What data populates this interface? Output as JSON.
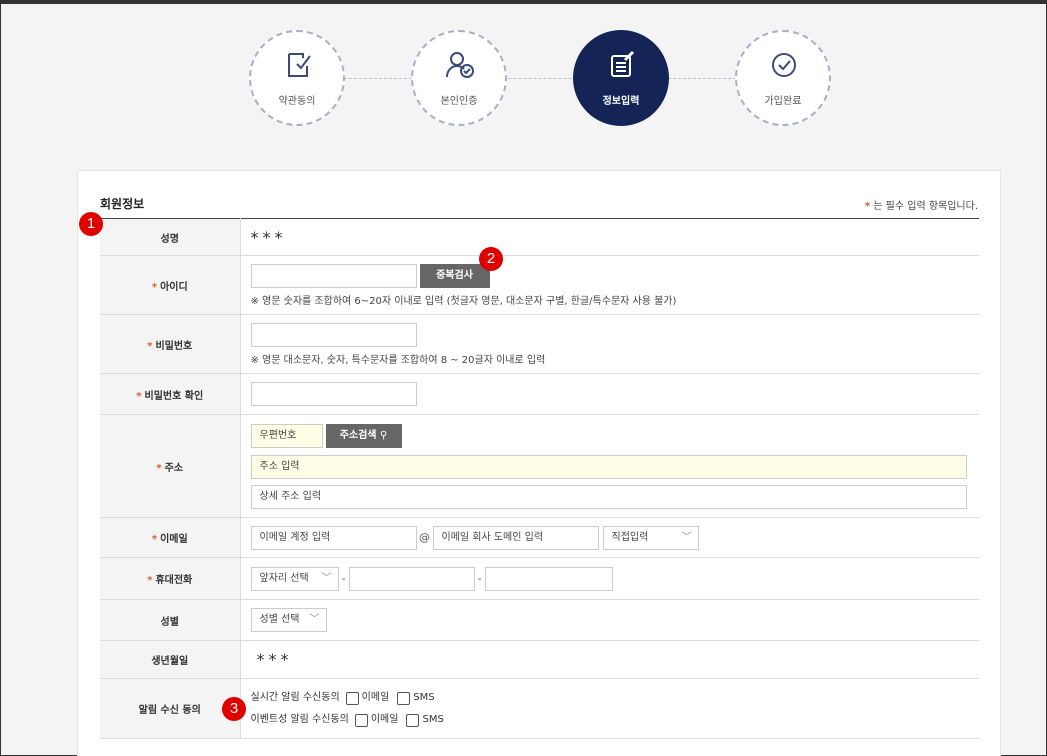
{
  "steps": [
    {
      "label": "약관동의",
      "icon": "document-check-icon",
      "active": false
    },
    {
      "label": "본인인증",
      "icon": "user-verify-icon",
      "active": false
    },
    {
      "label": "정보입력",
      "icon": "edit-document-icon",
      "active": true
    },
    {
      "label": "가입완료",
      "icon": "check-circle-icon",
      "active": false
    }
  ],
  "section": {
    "title": "회원정보",
    "required_star": "*",
    "required_note": "는 필수 입력 항목입니다."
  },
  "rows": {
    "name": {
      "label": "성명",
      "value": "***"
    },
    "userid": {
      "label": "아이디",
      "required": "*",
      "button": "중복검사",
      "hint": "※ 영문 숫자를 조합하여 6~20자 이내로 입력 (첫글자 영문, 대소문자 구별, 한글/특수문자 사용 불가)"
    },
    "password": {
      "label": "비밀번호",
      "required": "*",
      "hint": "※ 영문 대소문자, 숫자, 특수문자를 조합하여 8 ~ 20글자 이내로 입력"
    },
    "password_confirm": {
      "label": "비밀번호 확인",
      "required": "*"
    },
    "address": {
      "label": "주소",
      "required": "*",
      "zip_placeholder": "우편번호",
      "search_button": "주소검색",
      "addr1_placeholder": "주소 입력",
      "addr2_placeholder": "상세 주소 입력"
    },
    "email": {
      "label": "이메일",
      "required": "*",
      "account_placeholder": "이메일 계정 입력",
      "at": "@",
      "domain_placeholder": "이메일 회사 도메인 입력",
      "domain_select": "직접입력"
    },
    "phone": {
      "label": "휴대전화",
      "required": "*",
      "prefix_select": "앞자리 선택",
      "dash": "-"
    },
    "gender": {
      "label": "성별",
      "select": "성별 선택"
    },
    "birth": {
      "label": "생년월일",
      "value": "***"
    },
    "notify": {
      "label": "알림 수신 동의",
      "realtime_label": "실시간 알림 수신동의",
      "event_label": "이벤트성 알림 수신동의",
      "email_opt": "이메일",
      "sms_opt": "SMS"
    }
  },
  "badges": [
    "1",
    "2",
    "3"
  ]
}
